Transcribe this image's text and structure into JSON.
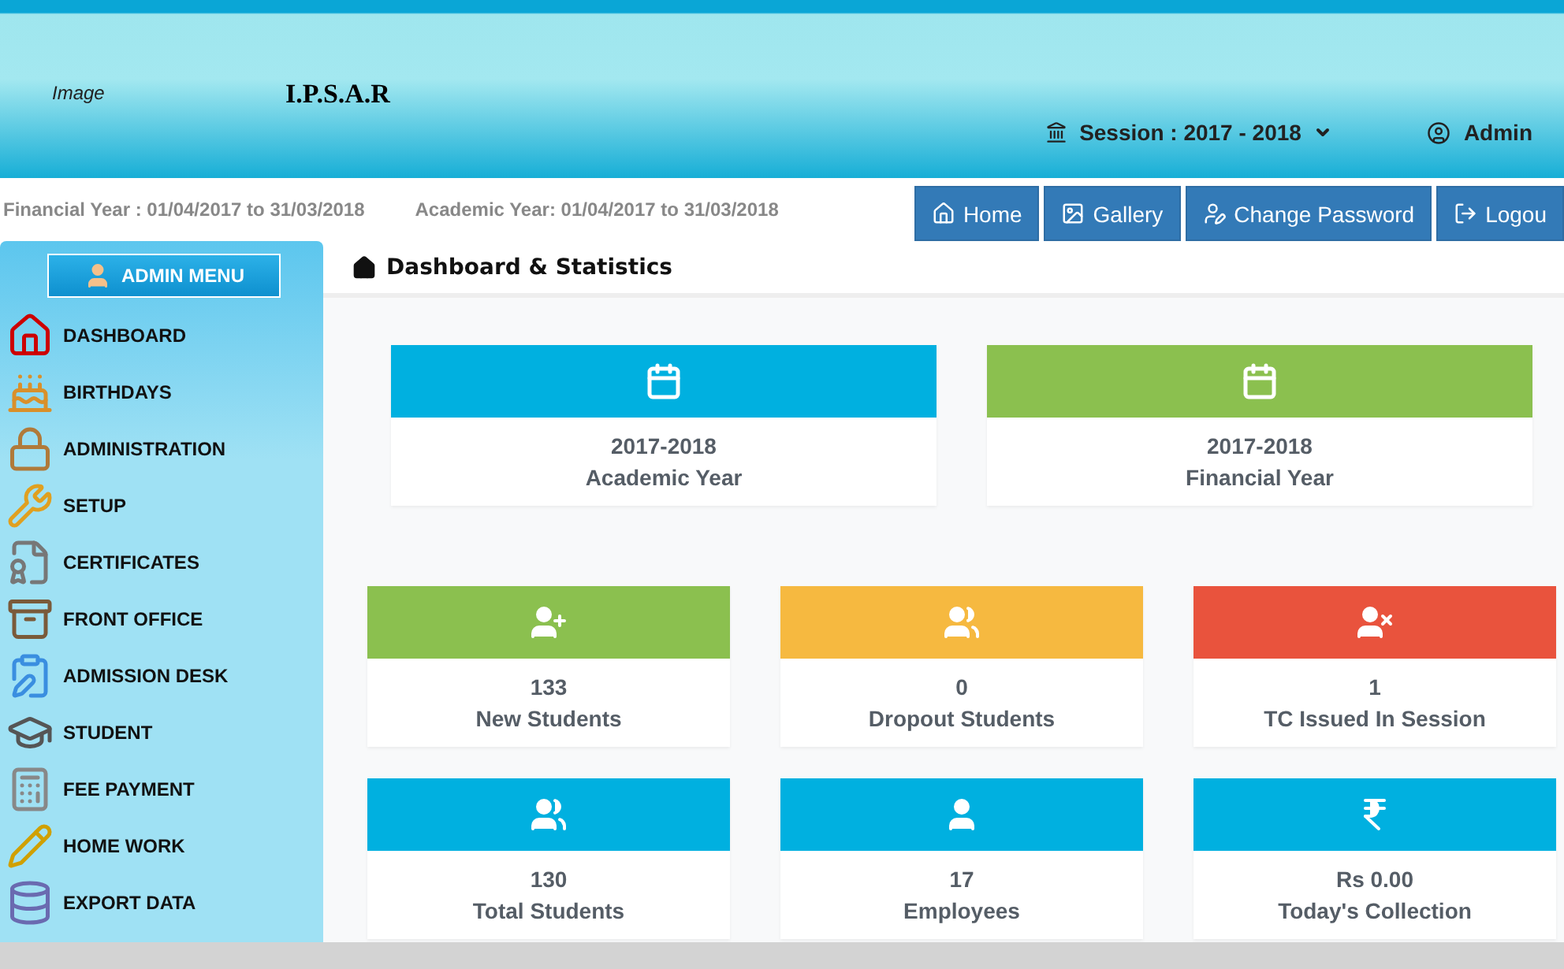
{
  "header": {
    "logo_alt": "Image",
    "title": "I.P.S.A.R",
    "session": "Session : 2017 - 2018",
    "user": "Admin"
  },
  "info_bar": {
    "financial_year": "Financial Year :  01/04/2017 to 31/03/2018",
    "academic_year": "Academic Year: 01/04/2017 to 31/03/2018"
  },
  "nav_buttons": [
    "Home",
    "Gallery",
    "Change Password",
    "Logou"
  ],
  "sidebar": {
    "title": "ADMIN MENU",
    "items": [
      "DASHBOARD",
      "BIRTHDAYS",
      "ADMINISTRATION",
      "SETUP",
      "CERTIFICATES",
      "FRONT OFFICE",
      "ADMISSION DESK",
      "STUDENT",
      "FEE PAYMENT",
      "HOME WORK",
      "EXPORT DATA"
    ]
  },
  "page_title": "Dashboard & Statistics",
  "year_cards": [
    {
      "value": "2017-2018",
      "label": "Academic Year",
      "color": "#00b0e0"
    },
    {
      "value": "2017-2018",
      "label": "Financial Year",
      "color": "#8bc04f"
    }
  ],
  "stat_cards": [
    {
      "value": "133",
      "label": "New Students",
      "color": "#8bc04f"
    },
    {
      "value": "0",
      "label": "Dropout Students",
      "color": "#f6b940"
    },
    {
      "value": "1",
      "label": "TC Issued In Session",
      "color": "#e9533d"
    },
    {
      "value": "130",
      "label": "Total Students",
      "color": "#00b0e0"
    },
    {
      "value": "17",
      "label": "Employees",
      "color": "#00b0e0"
    },
    {
      "value": "Rs 0.00",
      "label": "Today's Collection",
      "color": "#00b0e0"
    }
  ]
}
